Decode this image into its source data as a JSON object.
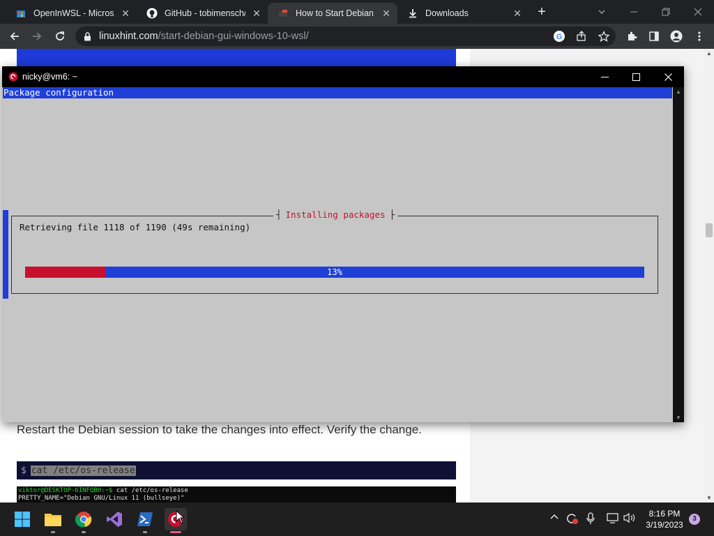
{
  "browser": {
    "tabs": [
      {
        "title": "OpenInWSL - Microsoft",
        "icon": "store-icon",
        "close": "✕"
      },
      {
        "title": "GitHub - tobimensch/a",
        "icon": "github-icon",
        "close": "✕"
      },
      {
        "title": "How to Start Debian G",
        "icon": "linuxhint-icon",
        "close": "✕"
      },
      {
        "title": "Downloads",
        "icon": "download-icon",
        "close": "✕"
      }
    ],
    "active_tab": 2,
    "url_host": "linuxhint.com",
    "url_path": "/start-debian-gui-windows-10-wsl/"
  },
  "webpage": {
    "restart_text": "Restart the Debian session to take the changes into effect. Verify the change.",
    "cmd_prompt": "$",
    "cmd_text": "cat /etc/os-release",
    "term_prompt": "viktor@DESKTOP-6INFQBH:~$",
    "term_cmd": " cat /etc/os-release",
    "term_line2": "PRETTY_NAME=\"Debian GNU/Linux 11 (bullseye)\""
  },
  "terminal": {
    "title": "nicky@vm6: ~",
    "header": "Package configuration",
    "dialog_title": "Installing packages",
    "message": "Retrieving file 1118 of 1190 (49s remaining)",
    "progress_percent": 13,
    "progress_label": "13%"
  },
  "taskbar": {
    "apps": [
      "start-icon",
      "file-explorer-icon",
      "chrome-icon",
      "visual-studio-icon",
      "powershell-icon",
      "debian-icon"
    ],
    "time": "8:16 PM",
    "date": "3/19/2023",
    "notification_count": "3"
  },
  "colors": {
    "debian_red": "#c8102e",
    "dialog_blue": "#1f3fd6"
  }
}
